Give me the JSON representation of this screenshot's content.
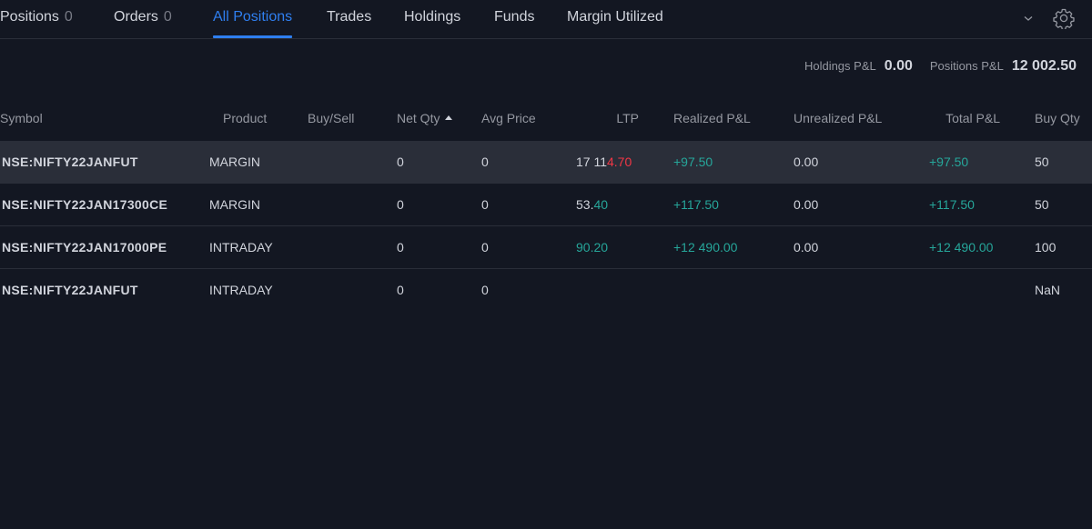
{
  "tabs": [
    {
      "label": "Positions",
      "count": "0"
    },
    {
      "label": "Orders",
      "count": "0"
    },
    {
      "label": "All Positions"
    },
    {
      "label": "Trades"
    },
    {
      "label": "Holdings"
    },
    {
      "label": "Funds"
    },
    {
      "label": "Margin Utilized"
    }
  ],
  "active_tab": "All Positions",
  "summary": {
    "holdings_label": "Holdings P&L",
    "holdings_value": "0.00",
    "positions_label": "Positions P&L",
    "positions_value": "12 002.50"
  },
  "columns": [
    "Symbol",
    "Product",
    "Buy/Sell",
    "Net Qty",
    "Avg Price",
    "LTP",
    "Realized P&L",
    "Unrealized P&L",
    "Total P&L",
    "Buy Qty"
  ],
  "sort": {
    "column": "Net Qty",
    "direction": "ascending"
  },
  "rows": [
    {
      "symbol": "NSE:NIFTY22JANFUT",
      "product": "MARGIN",
      "buy_sell": "",
      "net_qty": "0",
      "avg_price": "0",
      "ltp_main": "17 11",
      "ltp_tail": "4.70",
      "ltp_tail_color": "red",
      "realized": "+97.50",
      "unrealized": "0.00",
      "total": "+97.50",
      "buy_qty": "50"
    },
    {
      "symbol": "NSE:NIFTY22JAN17300CE",
      "product": "MARGIN",
      "buy_sell": "",
      "net_qty": "0",
      "avg_price": "0",
      "ltp_main": "53.",
      "ltp_tail": "40",
      "ltp_tail_color": "green",
      "realized": "+117.50",
      "unrealized": "0.00",
      "total": "+117.50",
      "buy_qty": "50"
    },
    {
      "symbol": "NSE:NIFTY22JAN17000PE",
      "product": "INTRADAY",
      "buy_sell": "",
      "net_qty": "0",
      "avg_price": "0",
      "ltp_main": "",
      "ltp_tail": "90.20",
      "ltp_tail_color": "green",
      "realized": "+12 490.00",
      "unrealized": "0.00",
      "total": "+12 490.00",
      "buy_qty": "100"
    },
    {
      "symbol": "NSE:NIFTY22JANFUT",
      "product": "INTRADAY",
      "buy_sell": "",
      "net_qty": "0",
      "avg_price": "0",
      "ltp_main": "",
      "ltp_tail": "",
      "ltp_tail_color": "",
      "realized": "",
      "unrealized": "",
      "total": "",
      "buy_qty": "NaN"
    }
  ],
  "selected_row": 0,
  "icons": {
    "menu": "chevron-down-icon",
    "settings": "gear-icon"
  },
  "colors": {
    "background": "#131722",
    "accent": "#2f7ff0",
    "profit": "#26a69a",
    "loss": "#f23645",
    "selected_row": "#2a2e39"
  }
}
